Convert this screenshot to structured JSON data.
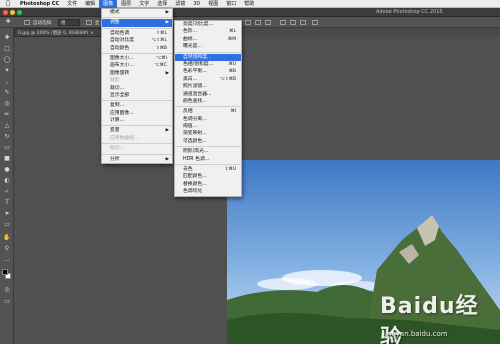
{
  "menubar": {
    "app_name": "Photoshop CC",
    "items": [
      "文件",
      "编辑",
      "图像",
      "图层",
      "文字",
      "选择",
      "滤镜",
      "3D",
      "视图",
      "窗口",
      "帮助"
    ],
    "active_index": 2
  },
  "window": {
    "title": "Adobe Photoshop CC 2015"
  },
  "options_bar": {
    "auto_select_label": "自动选择:",
    "auto_select_value": "组",
    "show_label": "显"
  },
  "document_tab": {
    "label": "0.jpg @ 200% (图层 0, RGB/8#) ×"
  },
  "image_menu": {
    "items": [
      {
        "label": "模式",
        "arrow": true
      },
      {
        "sep": true
      },
      {
        "label": "调整",
        "arrow": true,
        "highlight": true
      },
      {
        "sep": true
      },
      {
        "label": "自动色调",
        "shortcut": "⇧⌘L"
      },
      {
        "label": "自动对比度",
        "shortcut": "⌥⇧⌘L"
      },
      {
        "label": "自动颜色",
        "shortcut": "⇧⌘B"
      },
      {
        "sep": true
      },
      {
        "label": "图像大小...",
        "shortcut": "⌥⌘I"
      },
      {
        "label": "画布大小...",
        "shortcut": "⌥⌘C"
      },
      {
        "label": "图像旋转",
        "arrow": true
      },
      {
        "label": "裁剪",
        "disabled": true
      },
      {
        "label": "裁切..."
      },
      {
        "label": "显示全部"
      },
      {
        "sep": true
      },
      {
        "label": "复制..."
      },
      {
        "label": "应用图像..."
      },
      {
        "label": "计算..."
      },
      {
        "sep": true
      },
      {
        "label": "变量",
        "arrow": true
      },
      {
        "label": "应用数据组...",
        "disabled": true
      },
      {
        "sep": true
      },
      {
        "label": "陷印...",
        "disabled": true
      },
      {
        "sep": true
      },
      {
        "label": "分析",
        "arrow": true
      }
    ]
  },
  "adjust_menu": {
    "items": [
      {
        "label": "亮度/对比度..."
      },
      {
        "label": "色阶...",
        "shortcut": "⌘L"
      },
      {
        "label": "曲线...",
        "shortcut": "⌘M"
      },
      {
        "label": "曝光度..."
      },
      {
        "sep": true
      },
      {
        "label": "自然饱和度...",
        "highlight": true
      },
      {
        "label": "色相/饱和度...",
        "shortcut": "⌘U"
      },
      {
        "label": "色彩平衡...",
        "shortcut": "⌘B"
      },
      {
        "label": "黑白...",
        "shortcut": "⌥⇧⌘B"
      },
      {
        "label": "照片滤镜..."
      },
      {
        "label": "通道混合器..."
      },
      {
        "label": "颜色查找..."
      },
      {
        "sep": true
      },
      {
        "label": "反相",
        "shortcut": "⌘I"
      },
      {
        "label": "色调分离..."
      },
      {
        "label": "阈值..."
      },
      {
        "label": "渐变映射..."
      },
      {
        "label": "可选颜色..."
      },
      {
        "sep": true
      },
      {
        "label": "阴影/高光..."
      },
      {
        "label": "HDR 色调..."
      },
      {
        "sep": true
      },
      {
        "label": "去色",
        "shortcut": "⇧⌘U"
      },
      {
        "label": "匹配颜色..."
      },
      {
        "label": "替换颜色..."
      },
      {
        "label": "色调均化"
      }
    ]
  },
  "watermark": {
    "text": "Baidu经验",
    "url": "jingyan.baidu.com"
  },
  "colors": {
    "accent": "#2f6fe0",
    "sky": "#6f9fd6",
    "mountain": "#3f6a35"
  }
}
